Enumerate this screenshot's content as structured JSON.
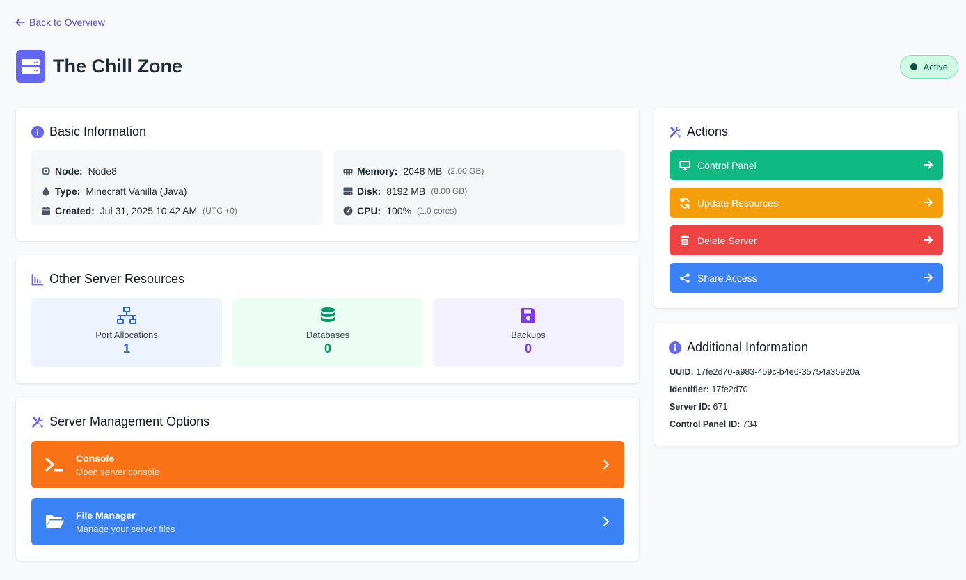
{
  "nav": {
    "back_label": "Back to Overview"
  },
  "header": {
    "title": "The Chill Zone",
    "status": "Active"
  },
  "basic_info": {
    "title": "Basic Information",
    "node_label": "Node:",
    "node_value": "Node8",
    "type_label": "Type:",
    "type_value": "Minecraft Vanilla (Java)",
    "created_label": "Created:",
    "created_value": "Jul 31, 2025 10:42 AM",
    "created_tz": "(UTC +0)",
    "memory_label": "Memory:",
    "memory_value": "2048 MB",
    "memory_extra": "(2.00 GB)",
    "disk_label": "Disk:",
    "disk_value": "8192 MB",
    "disk_extra": "(8.00 GB)",
    "cpu_label": "CPU:",
    "cpu_value": "100%",
    "cpu_extra": "(1.0 cores)"
  },
  "resources": {
    "title": "Other Server Resources",
    "items": [
      {
        "label": "Port Allocations",
        "value": "1",
        "bg": "#eef4ff",
        "color": "#2563eb",
        "icon": "network-icon"
      },
      {
        "label": "Databases",
        "value": "0",
        "bg": "#ecfdf3",
        "color": "#059669",
        "icon": "database-icon"
      },
      {
        "label": "Backups",
        "value": "0",
        "bg": "#f3f1fd",
        "color": "#7c3aed",
        "icon": "save-icon"
      }
    ]
  },
  "management": {
    "title": "Server Management Options",
    "console_title": "Console",
    "console_sub": "Open server console",
    "files_title": "File Manager",
    "files_sub": "Manage your server files"
  },
  "actions": {
    "title": "Actions",
    "control_panel": "Control Panel",
    "update_resources": "Update Resources",
    "delete_server": "Delete Server",
    "share_access": "Share Access"
  },
  "additional": {
    "title": "Additional Information",
    "uuid_label": "UUID:",
    "uuid_value": "17fe2d70-a983-459c-b4e6-35754a35920a",
    "identifier_label": "Identifier:",
    "identifier_value": "17fe2d70",
    "server_id_label": "Server ID:",
    "server_id_value": "671",
    "cp_id_label": "Control Panel ID:",
    "cp_id_value": "734"
  },
  "colors": {
    "accent": "#6366f1",
    "green": "#10b981",
    "amber": "#f59e0b",
    "red": "#ef4444",
    "blue": "#3b82f6",
    "orange": "#f97316"
  }
}
